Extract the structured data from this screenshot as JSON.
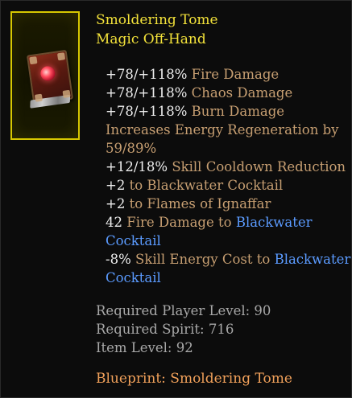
{
  "item": {
    "name": "Smoldering Tome",
    "type": "Magic Off-Hand",
    "icon": "tome-icon",
    "rarity_color": "#f3e23a"
  },
  "affixes": {
    "fire_damage": {
      "value": "+78/+118%",
      "label": "Fire Damage"
    },
    "chaos_damage": {
      "value": "+78/+118%",
      "label": "Chaos Damage"
    },
    "burn_damage": {
      "value": "+78/+118%",
      "label": "Burn Damage"
    },
    "energy_regen": {
      "label": "Increases Energy Regeneration by",
      "value": "59/89%"
    },
    "cooldown": {
      "value": "+12/18%",
      "label": "Skill Cooldown Reduction"
    },
    "blackwater_bonus": {
      "value": "+2",
      "label": "to Blackwater Cocktail"
    },
    "flames_bonus": {
      "value": "+2",
      "label": "to Flames of Ignaffar"
    },
    "fire_to_skill": {
      "value": "42",
      "label": "Fire Damage to",
      "skill_line1": "Blackwater",
      "skill_line2": "Cocktail"
    },
    "energy_cost": {
      "value": "-8%",
      "label": "Skill Energy Cost to",
      "skill_line1": "Blackwater",
      "skill_line2": "Cocktail"
    }
  },
  "requirements": {
    "player_level": "Required Player Level: 90",
    "spirit": "Required Spirit: 716",
    "item_level": "Item Level: 92"
  },
  "blueprint": "Blueprint: Smoldering Tome",
  "colors": {
    "affix_text": "#c79f72",
    "affix_number": "#eeeeee",
    "skill_link": "#5b9bff",
    "requirement_text": "#a8a8a8",
    "blueprint_text": "#f0a05a",
    "frame_border": "#d7c800"
  }
}
